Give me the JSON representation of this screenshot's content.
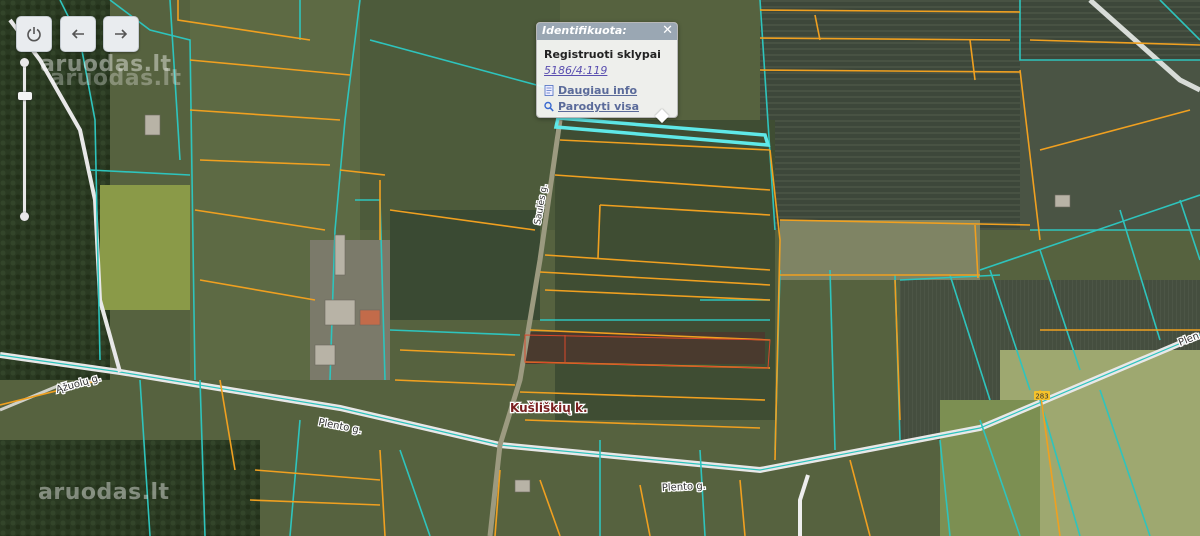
{
  "controls": {
    "power_icon": "power-icon",
    "back_icon": "arrow-left-icon",
    "forward_icon": "arrow-right-icon",
    "zoom_level": 0.77
  },
  "watermarks": [
    "aruodas.lt",
    "aruodas.lt",
    "aruodas.lt"
  ],
  "map_labels": {
    "village": "Kušliškių k.",
    "road_main": "Plento g.",
    "road_main_2": "Plento g.",
    "road_lower": "Plento g.",
    "road_left": "Ąžuolų g.",
    "road_vertical": "Saulės g.",
    "road_right": "Plen",
    "road_shield": "283"
  },
  "popup": {
    "title": "Identifikuota:",
    "close": "✕",
    "layer": "Registruoti sklypai",
    "parcel": "5186/4:119",
    "more_info": "Daugiau info",
    "show_all": "Parodyti visa"
  },
  "colors": {
    "parcel_orange": "#f0a020",
    "cadastre_teal": "#2ec4bd",
    "highlight": "#5fe8e8",
    "road": "#f4f4f4"
  }
}
